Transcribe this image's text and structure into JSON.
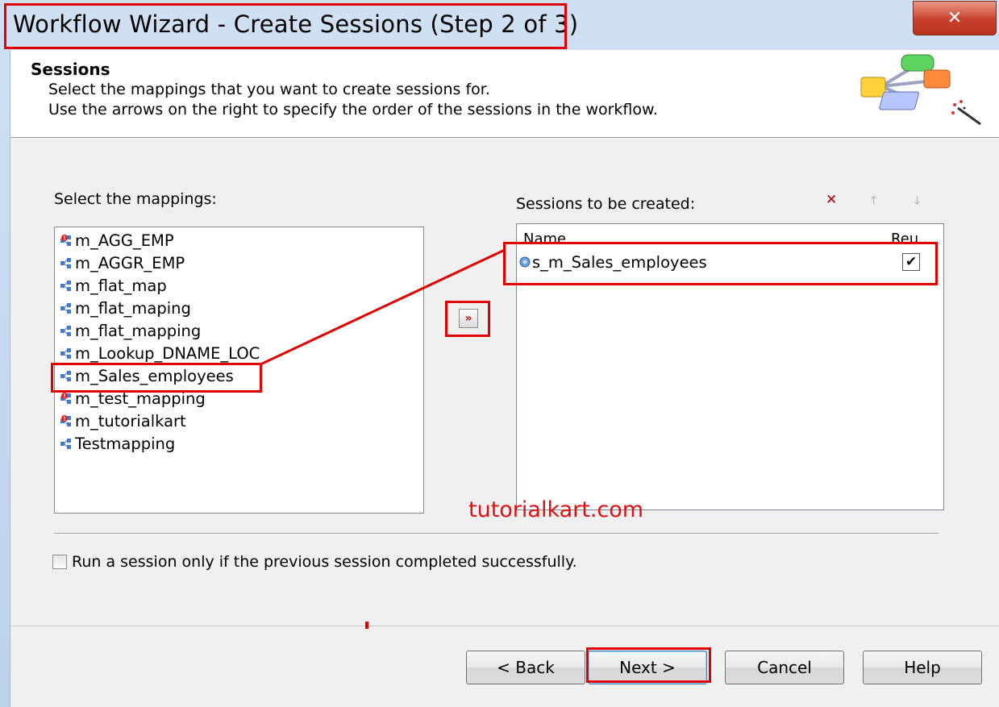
{
  "window": {
    "title": "Workflow Wizard - Create Sessions (Step 2 of 3)",
    "close_label": "✕"
  },
  "header": {
    "title": "Sessions",
    "line1": "Select the mappings that you want to create sessions for.",
    "line2": "Use the arrows on the right to specify the order of the sessions in the workflow."
  },
  "mappings": {
    "label": "Select the mappings:",
    "items": [
      {
        "label": "m_AGG_EMP",
        "icon": "mapping-invalid-icon"
      },
      {
        "label": "m_AGGR_EMP",
        "icon": "mapping-icon"
      },
      {
        "label": "m_flat_map",
        "icon": "mapping-icon"
      },
      {
        "label": "m_flat_maping",
        "icon": "mapping-icon"
      },
      {
        "label": "m_flat_mapping",
        "icon": "mapping-icon"
      },
      {
        "label": "m_Lookup_DNAME_LOC",
        "icon": "mapping-icon"
      },
      {
        "label": "m_Sales_employees",
        "icon": "mapping-icon"
      },
      {
        "label": "m_test_mapping",
        "icon": "mapping-invalid-icon"
      },
      {
        "label": "m_tutorialkart",
        "icon": "mapping-invalid-icon"
      },
      {
        "label": "Testmapping",
        "icon": "mapping-icon"
      }
    ]
  },
  "add_button": {
    "label": "»"
  },
  "sessions": {
    "label": "Sessions to be created:",
    "col_name": "Name",
    "col_reuse": "Reu...",
    "rows": [
      {
        "name": "s_m_Sales_employees",
        "reusable": true
      }
    ],
    "tools": {
      "delete": "✕",
      "up": "🡑",
      "down": "🡓"
    }
  },
  "option": {
    "label": "Run a session only if the previous session completed successfully.",
    "checked": false
  },
  "buttons": {
    "back": "< Back",
    "next": "Next >",
    "cancel": "Cancel",
    "help": "Help"
  },
  "watermark": "tutorialkart.com",
  "colors": {
    "annotation": "#e00000",
    "watermark": "#e01010"
  }
}
